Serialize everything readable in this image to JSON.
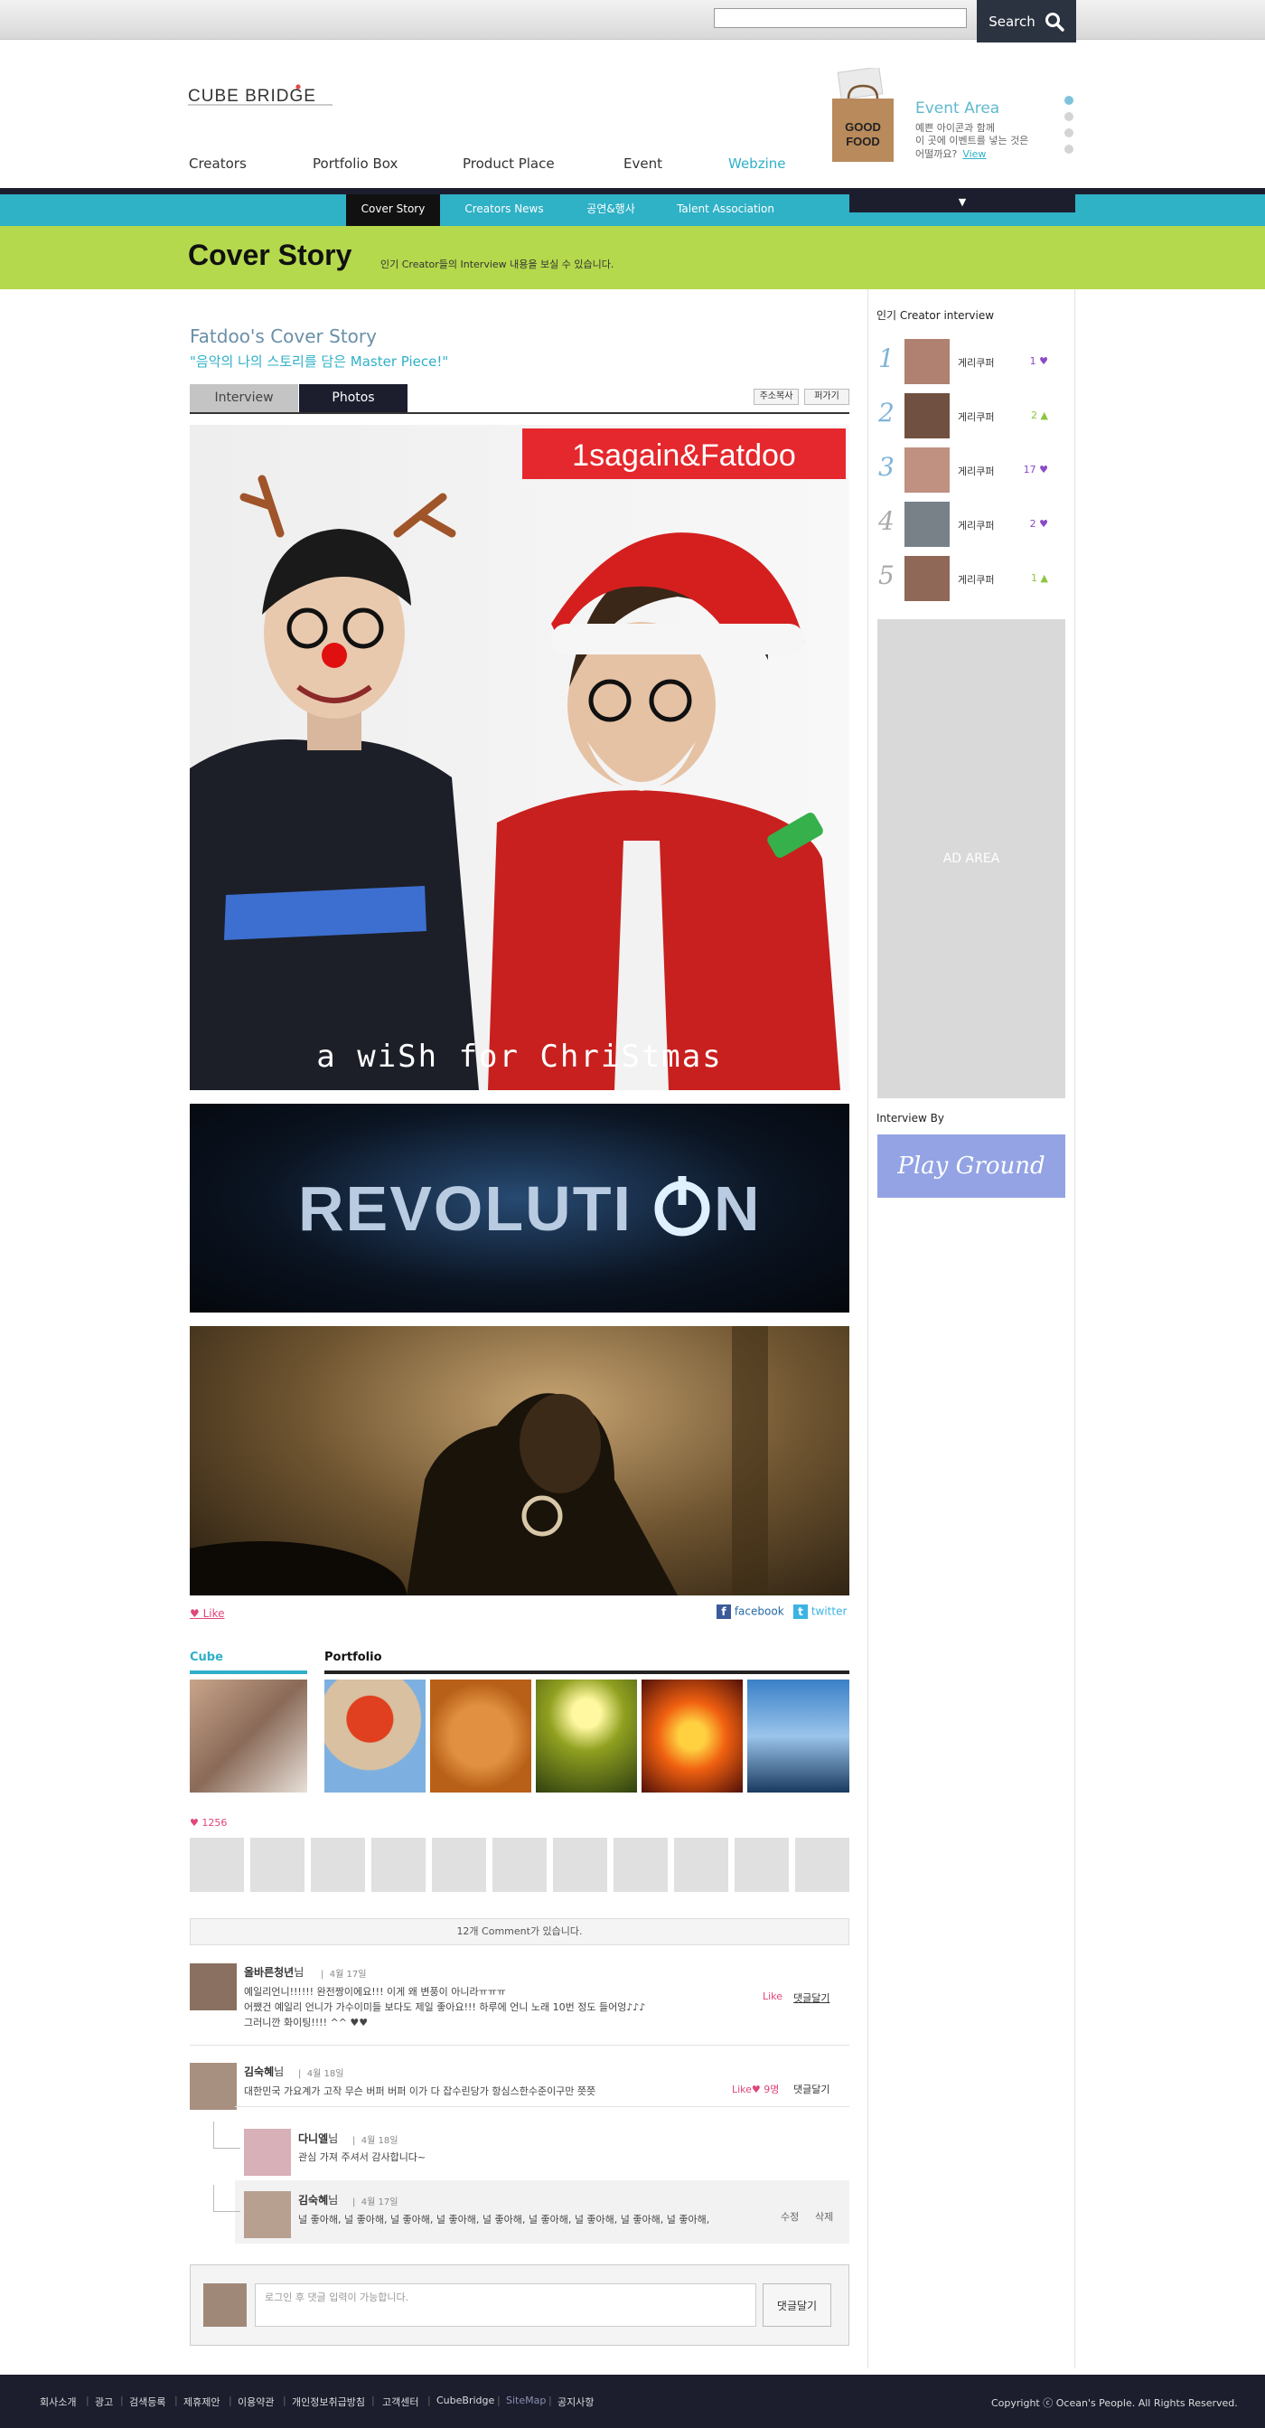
{
  "header": {
    "search_placeholder": "",
    "search_label": "Search",
    "logo_text": "CUBE BRIDGE"
  },
  "gnb": [
    "Creators",
    "Portfolio Box",
    "Product Place",
    "Event",
    "Webzine"
  ],
  "event": {
    "bag_text": "GOOD FOOD",
    "title": "Event Area",
    "lines": [
      "예쁜 아이콘과 함께",
      "이 곳에 이벤트를 넣는 것은"
    ],
    "line3": "어떨까요?",
    "view": "View"
  },
  "subnav": [
    "Cover Story",
    "Creators News",
    "공연&행사",
    "Talent Association"
  ],
  "subnav_drop": "▼",
  "page": {
    "title": "Cover Story",
    "desc": "인기 Creator들의 Interview 내용을 보실 수 있습니다."
  },
  "story": {
    "title": "Fatdoo's Cover Story",
    "subtitle": "\"음악의 나의 스토리를 담은 Master Piece!\"",
    "tabs": [
      "Interview",
      "Photos"
    ],
    "btn_copy": "주소복사",
    "btn_share": "퍼가기"
  },
  "photos": {
    "banner": "1sagain&Fatdoo",
    "caption1": "a wiSh for ChriStmas",
    "revolution": "REVOLUTI",
    "revolution_end": "N"
  },
  "social": {
    "like": "Like",
    "facebook": "facebook",
    "twitter": "twitter"
  },
  "portfolio": {
    "cube_label": "Cube",
    "portfolio_label": "Portfolio"
  },
  "likes": {
    "count": "1256"
  },
  "comments": {
    "count_text": "12개 Comment가 있습니다.",
    "items": [
      {
        "name": "올바른청년",
        "suffix": "님",
        "date": "4월 17일",
        "lines": [
          "예일리언니!!!!!! 완전짱이에요!!! 이게 왜 변풍이 아니라ㅠㅠㅠ",
          "어쨌건 예일리 언니가 가수이미들 보다도 제일 좋아요!!! 하루에 언니 노래 10번 정도 들어엉♪♪♪",
          "그러니깐 화이팅!!!! ^^ ♥♥"
        ],
        "like": "Like",
        "reply": "댓글달기"
      },
      {
        "name": "김숙혜",
        "suffix": "님",
        "date": "4월 18일",
        "lines": [
          "대한민국 가요계가 고작 무슨 버퍼 버퍼 이가 다 잡수린당가 항심스한수준이구만 쯧쯧"
        ],
        "like": "Like♥ 9명",
        "reply": "댓글달기"
      }
    ],
    "replies": [
      {
        "name": "다니엘",
        "suffix": "님",
        "date": "4월 18일",
        "text": "관심 가져 주셔서 감사합니다~"
      },
      {
        "name": "김숙혜",
        "suffix": "님",
        "date": "4월 17일",
        "text": "널 좋아해, 널 좋아해, 널 좋아해, 널 좋아해, 널 좋아해, 널 좋아해, 널 좋아해, 널 좋아해, 널 좋아해,",
        "edit": "수정",
        "delete": "삭제"
      }
    ],
    "input_placeholder": "로그인 후 댓글 입력이 가능합니다.",
    "submit": "댓글달기"
  },
  "sidebar": {
    "title": "인기 Creator interview",
    "ranks": [
      {
        "num": "1",
        "name": "게리쿠퍼",
        "count": "1"
      },
      {
        "num": "2",
        "name": "게리쿠퍼",
        "count": "2"
      },
      {
        "num": "3",
        "name": "게리쿠퍼",
        "count": "17"
      },
      {
        "num": "4",
        "name": "게리쿠퍼",
        "count": "2"
      },
      {
        "num": "5",
        "name": "게리쿠퍼",
        "count": "1"
      }
    ],
    "ad": "AD AREA",
    "interview_by": "Interview By",
    "playground": "Play Ground"
  },
  "footer": {
    "items": [
      "회사소개",
      "광고",
      "검색등록",
      "제휴제안",
      "이용약관",
      "개인정보취급방침",
      "고객센터",
      "CubeBridge",
      "SiteMap",
      "공지사항"
    ],
    "copyright": "Copyright ⓒ Ocean's People. All Rights Reserved."
  },
  "colors": {
    "accent": "#2fb1c6",
    "lime": "#b4d94c",
    "navy": "#1c1e2e",
    "pink": "#e0457b"
  }
}
